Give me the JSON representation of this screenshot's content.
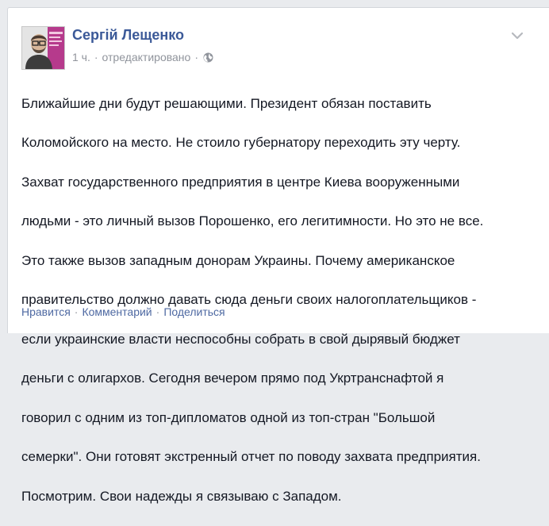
{
  "post": {
    "author": "Сергій Лещенко",
    "time": "1 ч.",
    "edited": "отредактировано",
    "separator": "·",
    "icons": {
      "audience": "globe-icon",
      "menu": "chevron-down-icon",
      "avatar": "profile-photo"
    },
    "lines": [
      "Ближайшие дни будут решающими. Президент обязан поставить",
      "Коломойского на место. Не стоило губернатору переходить эту черту.",
      "Захват государственного предприятия в центре Киева вооруженными",
      "людьми - это личный вызов Порошенко, его легитимности. Но это не все.",
      "Это также вызов западным донорам Украины. Почему американское",
      "правительство должно давать сюда деньги своих налогоплательщиков -",
      "если украинские власти неспособны собрать в свой дырявый бюджет",
      "деньги с олигархов. Сегодня вечером прямо под Укртранснафтой я",
      "говорил с одним из топ-дипломатов одной из топ-стран \"Большой",
      "семерки\". Они готовят экстренный отчет по поводу захвата предприятия.",
      "Посмотрим. Свои надежды я связываю с Западом."
    ]
  },
  "actions": {
    "like": "Нравится",
    "comment": "Комментарий",
    "share": "Поделиться",
    "separator": "·"
  },
  "colors": {
    "name": "#3b5998",
    "meta": "#90949c",
    "text": "#141823",
    "link": "#4e69a2",
    "background": "#e9ebee"
  }
}
